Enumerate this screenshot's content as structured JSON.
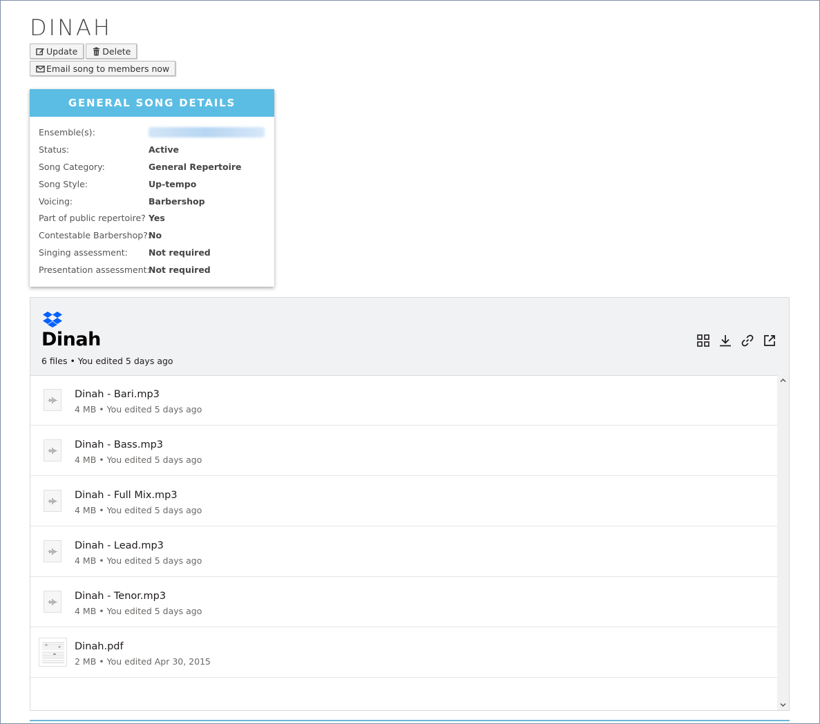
{
  "song": {
    "title": "DINAH",
    "buttons": {
      "update": "Update",
      "delete": "Delete",
      "email": "Email song to members now"
    }
  },
  "details": {
    "header": "GENERAL SONG DETAILS",
    "rows": [
      {
        "label": "Ensemble(s):",
        "value": ""
      },
      {
        "label": "Status:",
        "value": "Active"
      },
      {
        "label": "Song Category:",
        "value": "General Repertoire"
      },
      {
        "label": "Song Style:",
        "value": "Up-tempo"
      },
      {
        "label": "Voicing:",
        "value": "Barbershop"
      },
      {
        "label": "Part of public repertoire?",
        "value": "Yes"
      },
      {
        "label": "Contestable Barbershop?:",
        "value": "No"
      },
      {
        "label": "Singing assessment:",
        "value": "Not required"
      },
      {
        "label": "Presentation assessment:",
        "value": "Not required"
      }
    ]
  },
  "dropbox": {
    "title": "Dinah",
    "subtitle": "6 files • You edited 5 days ago",
    "files": [
      {
        "name": "Dinah - Bari.mp3",
        "meta": "4 MB • You edited 5 days ago",
        "icon": "audio-file-icon"
      },
      {
        "name": "Dinah - Bass.mp3",
        "meta": "4 MB • You edited 5 days ago",
        "icon": "audio-file-icon"
      },
      {
        "name": "Dinah - Full Mix.mp3",
        "meta": "4 MB • You edited 5 days ago",
        "icon": "audio-file-icon"
      },
      {
        "name": "Dinah - Lead.mp3",
        "meta": "4 MB • You edited 5 days ago",
        "icon": "audio-file-icon"
      },
      {
        "name": "Dinah - Tenor.mp3",
        "meta": "4 MB • You edited 5 days ago",
        "icon": "audio-file-icon"
      },
      {
        "name": "Dinah.pdf",
        "meta": "2 MB • You edited Apr 30, 2015",
        "icon": "pdf-thumbnail-icon"
      }
    ]
  },
  "colors": {
    "details_header": "#5bbde4",
    "dropbox_blue": "#0061fe"
  }
}
